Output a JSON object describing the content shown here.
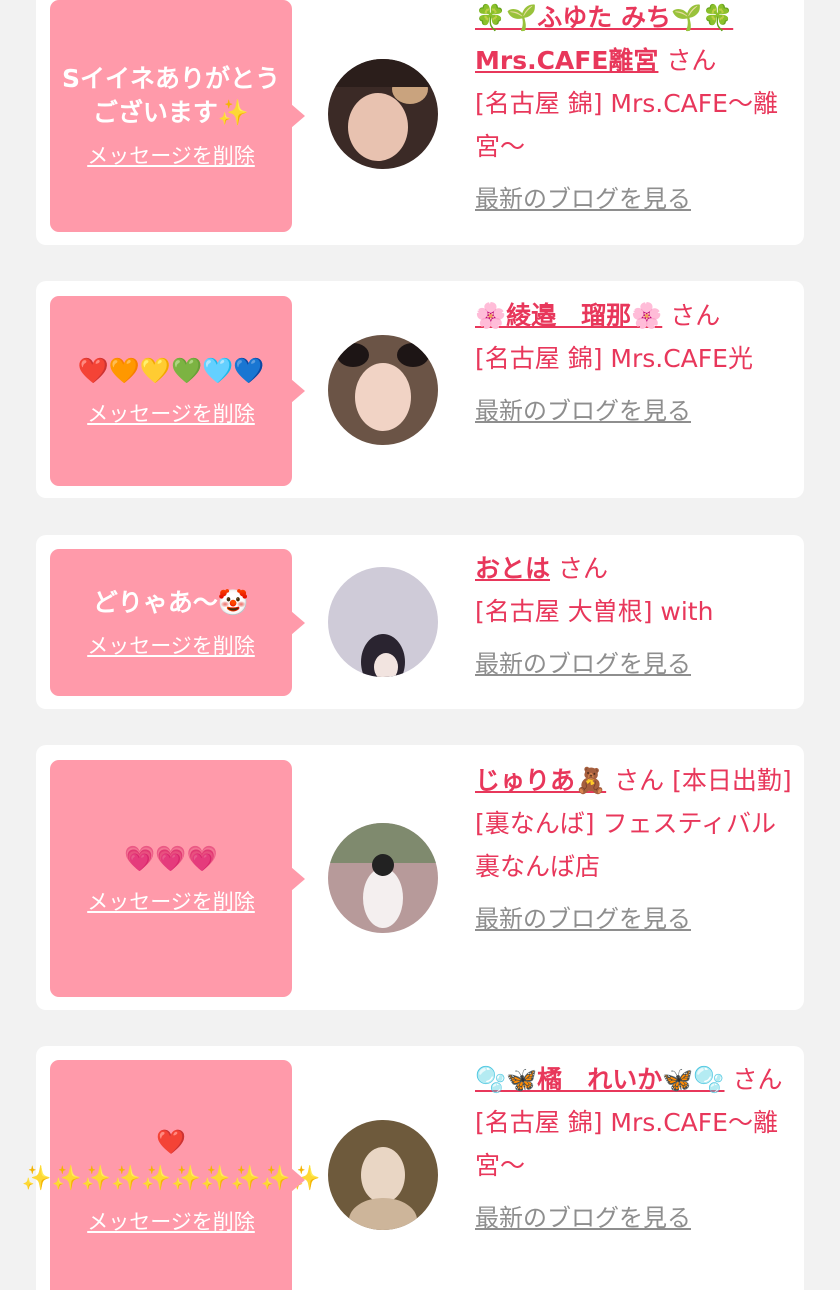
{
  "entries": [
    {
      "message": "Sイイネありがとうございます✨",
      "delete_label": "メッセージを削除",
      "name": "🍀🌱ふゆた みち🌱🍀 Mrs.CAFE離宮",
      "san": "さん",
      "badge": "",
      "area": "[名古屋 錦] Mrs.CAFE〜離宮〜",
      "blog_label": "最新のブログを見る",
      "avatar_colors": [
        "#3b2a26",
        "#e8c2b0"
      ]
    },
    {
      "message": "❤️🧡💛💚🩵💙",
      "delete_label": "メッセージを削除",
      "name": "🌸綾邉　瑠那🌸",
      "san": "さん",
      "badge": "",
      "area": "[名古屋 錦] Mrs.CAFE光",
      "blog_label": "最新のブログを見る",
      "avatar_colors": [
        "#6b5446",
        "#f1d3c5"
      ]
    },
    {
      "message": "どりゃあ〜🤡",
      "delete_label": "メッセージを削除",
      "name": "おとは",
      "san": "さん",
      "badge": "",
      "area": "[名古屋 大曽根] with",
      "blog_label": "最新のブログを見る",
      "avatar_colors": [
        "#cfcbd8",
        "#2a2430"
      ]
    },
    {
      "message": "💗💗💗",
      "delete_label": "メッセージを削除",
      "name": "じゅりあ🧸",
      "san": "さん",
      "badge": "[本日出勤]",
      "area": "[裏なんば] フェスティバル 裏なんば店",
      "blog_label": "最新のブログを見る",
      "avatar_colors": [
        "#b79a9a",
        "#f4efef"
      ]
    },
    {
      "message": "❤️ ✨✨✨✨✨✨✨✨✨✨",
      "delete_label": "メッセージを削除",
      "name": "🫧🦋橘　れいか🦋🫧",
      "san": "さん",
      "badge": "",
      "area": "[名古屋 錦] Mrs.CAFE〜離宮〜",
      "blog_label": "最新のブログを見る",
      "avatar_colors": [
        "#6e5a3c",
        "#e9d6c4"
      ]
    }
  ]
}
